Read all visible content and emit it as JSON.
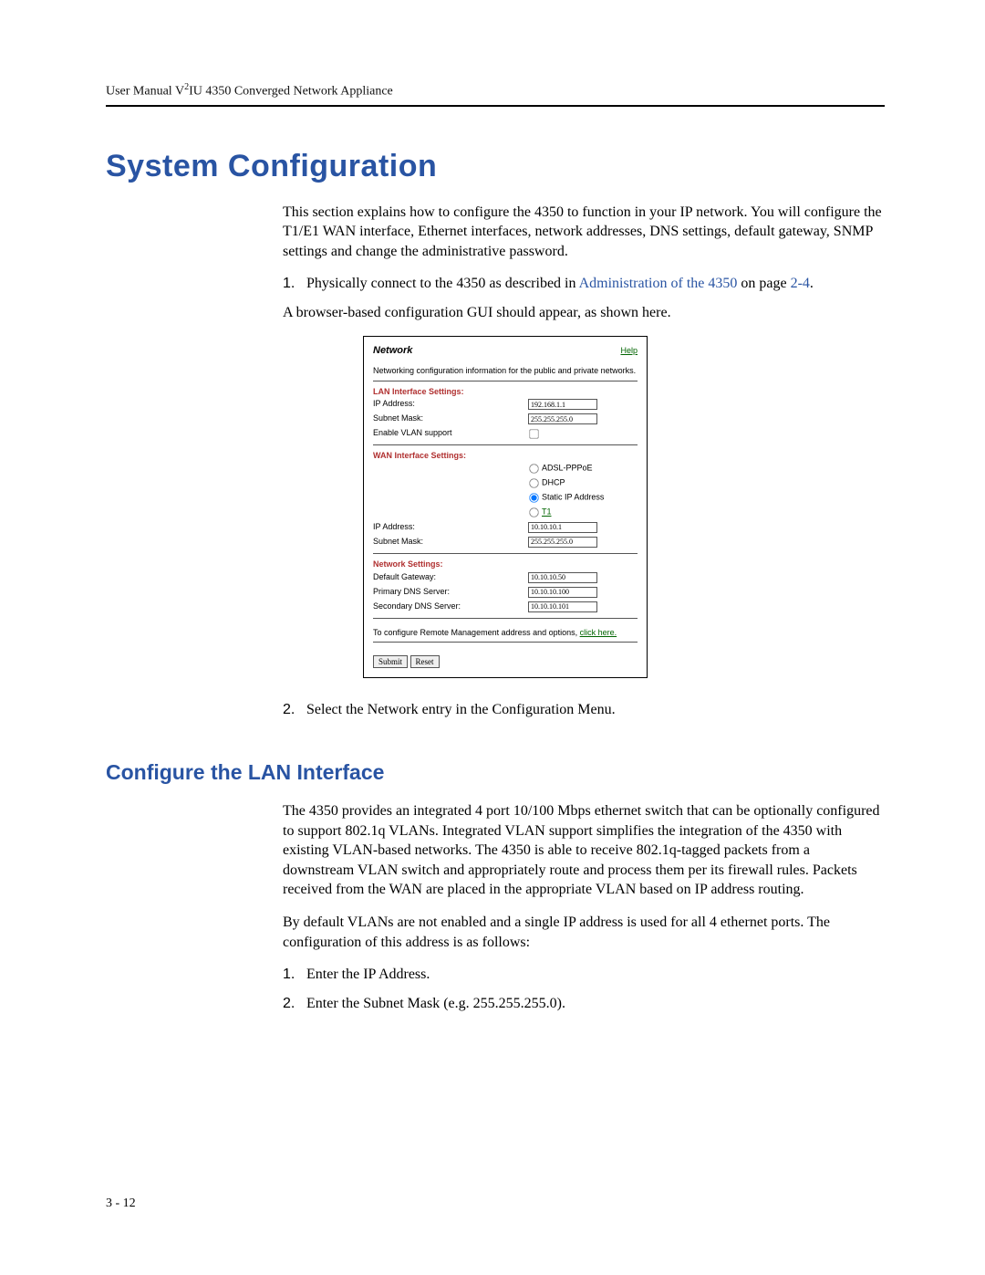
{
  "header": {
    "line_before_sup": "User Manual V",
    "sup": "2",
    "line_after_sup": "IU 4350 Converged Network Appliance"
  },
  "section_title": "System Configuration",
  "intro_para": "This section explains how to configure the 4350 to function in your IP network. You will configure the T1/E1 WAN interface, Ethernet interfaces, network addresses, DNS settings, default gateway, SNMP settings and change the administrative password.",
  "step1": {
    "num": "1.",
    "text_before_link": "Physically connect to the 4350 as described in ",
    "link_text": "Administration of the 4350",
    "text_mid": " on page ",
    "page_link": "2-4",
    "text_after": ".",
    "followup": "A browser-based configuration GUI should appear, as shown here."
  },
  "network_gui": {
    "title": "Network",
    "help": "Help",
    "desc": "Networking configuration information for the public and private networks.",
    "lan": {
      "heading": "LAN Interface Settings:",
      "ip_label": "IP Address:",
      "ip_value": "192.168.1.1",
      "mask_label": "Subnet Mask:",
      "mask_value": "255.255.255.0",
      "vlan_label": "Enable VLAN support"
    },
    "wan": {
      "heading": "WAN Interface Settings:",
      "opt_adsl": "ADSL-PPPoE",
      "opt_dhcp": "DHCP",
      "opt_static": "Static IP Address",
      "opt_t1": "T1",
      "ip_label": "IP Address:",
      "ip_value": "10.10.10.1",
      "mask_label": "Subnet Mask:",
      "mask_value": "255.255.255.0"
    },
    "net": {
      "heading": "Network Settings:",
      "gw_label": "Default Gateway:",
      "gw_value": "10.10.10.50",
      "pdns_label": "Primary DNS Server:",
      "pdns_value": "10.10.10.100",
      "sdns_label": "Secondary DNS Server:",
      "sdns_value": "10.10.10.101"
    },
    "remote_before": "To configure Remote Management address and options, ",
    "remote_link": "click here.",
    "submit": "Submit",
    "reset": "Reset"
  },
  "step2": {
    "num": "2.",
    "text": "Select the Network entry in the Configuration Menu."
  },
  "subsection_title": "Configure the LAN Interface",
  "lan_para1": "The 4350 provides an integrated 4 port 10/100 Mbps ethernet switch that can be optionally configured to support 802.1q VLANs. Integrated VLAN support simplifies the integration of the 4350 with existing VLAN-based networks. The 4350 is able to receive 802.1q-tagged packets from a downstream VLAN switch and appropriately route and process them per its firewall rules. Packets received from the WAN are placed in the appropriate VLAN based on IP address routing.",
  "lan_para2": "By default VLANs are not enabled and a single IP address is used for all 4 ethernet ports. The configuration of this address is as follows:",
  "lan_step1": {
    "num": "1.",
    "text": "Enter the IP Address."
  },
  "lan_step2": {
    "num": "2.",
    "text": "Enter the Subnet Mask (e.g. 255.255.255.0)."
  },
  "page_number": "3 - 12"
}
